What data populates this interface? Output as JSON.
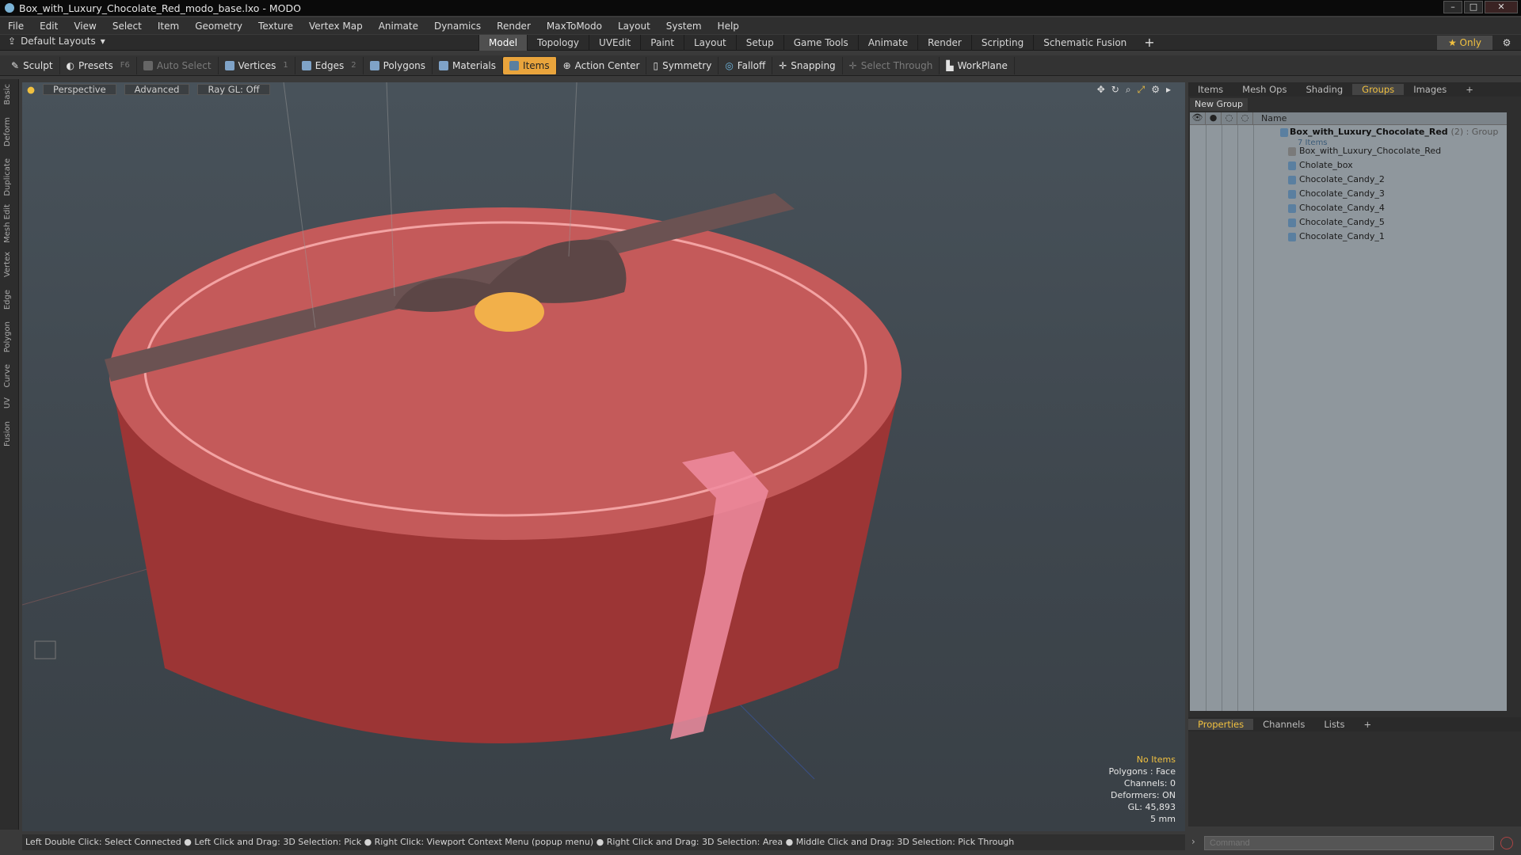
{
  "window": {
    "title": "Box_with_Luxury_Chocolate_Red_modo_base.lxo - MODO"
  },
  "menu": [
    "File",
    "Edit",
    "View",
    "Select",
    "Item",
    "Geometry",
    "Texture",
    "Vertex Map",
    "Animate",
    "Dynamics",
    "Render",
    "MaxToModo",
    "Layout",
    "System",
    "Help"
  ],
  "layout": {
    "default_layouts": "Default Layouts",
    "tabs": [
      "Model",
      "Topology",
      "UVEdit",
      "Paint",
      "Layout",
      "Setup",
      "Game Tools",
      "Animate",
      "Render",
      "Scripting",
      "Schematic Fusion"
    ],
    "active_tab": "Model",
    "only_label": "Only"
  },
  "toolbar": {
    "sculpt": "Sculpt",
    "presets": "Presets",
    "presets_key": "F6",
    "auto_select": "Auto Select",
    "vertices": "Vertices",
    "vertices_key": "1",
    "edges": "Edges",
    "edges_key": "2",
    "polygons": "Polygons",
    "materials": "Materials",
    "items": "Items",
    "action_center": "Action Center",
    "symmetry": "Symmetry",
    "falloff": "Falloff",
    "snapping": "Snapping",
    "select_through": "Select Through",
    "workplane": "WorkPlane"
  },
  "left_tabs": [
    "Basic",
    "Deform",
    "Duplicate",
    "Mesh Edit",
    "Vertex",
    "Edge",
    "Polygon",
    "Curve",
    "UV",
    "Fusion"
  ],
  "viewport": {
    "view": "Perspective",
    "shading": "Advanced",
    "raygl": "Ray GL: Off",
    "info": {
      "no_items": "No Items",
      "polygons": "Polygons : Face",
      "channels": "Channels: 0",
      "deformers": "Deformers: ON",
      "gl": "GL: 45,893",
      "scale": "5 mm"
    },
    "colors": {
      "box_top": "#c45a5a",
      "box_side": "#9c3535",
      "ribbon": "#6b5252",
      "tag": "#f2b04a",
      "band": "#f08ca0"
    }
  },
  "right_panel": {
    "tabs": [
      "Items",
      "Mesh Ops",
      "Shading",
      "Groups",
      "Images"
    ],
    "active_tab": "Groups",
    "new_group": "New Group",
    "column_name": "Name",
    "group": {
      "name": "Box_with_Luxury_Chocolate_Red",
      "suffix": "(2) : Group",
      "count": "7 Items"
    },
    "items": [
      "Box_with_Luxury_Chocolate_Red",
      "Cholate_box",
      "Chocolate_Candy_2",
      "Chocolate_Candy_3",
      "Chocolate_Candy_4",
      "Chocolate_Candy_5",
      "Chocolate_Candy_1"
    ]
  },
  "bottom_panel": {
    "tabs": [
      "Properties",
      "Channels",
      "Lists"
    ],
    "active_tab": "Properties"
  },
  "status": {
    "hint": "Left Double Click: Select Connected ● Left Click and Drag: 3D Selection: Pick ● Right Click: Viewport Context Menu (popup menu) ● Right Click and Drag: 3D Selection: Area ● Middle Click and Drag: 3D Selection: Pick Through"
  },
  "command": {
    "placeholder": "Command"
  }
}
